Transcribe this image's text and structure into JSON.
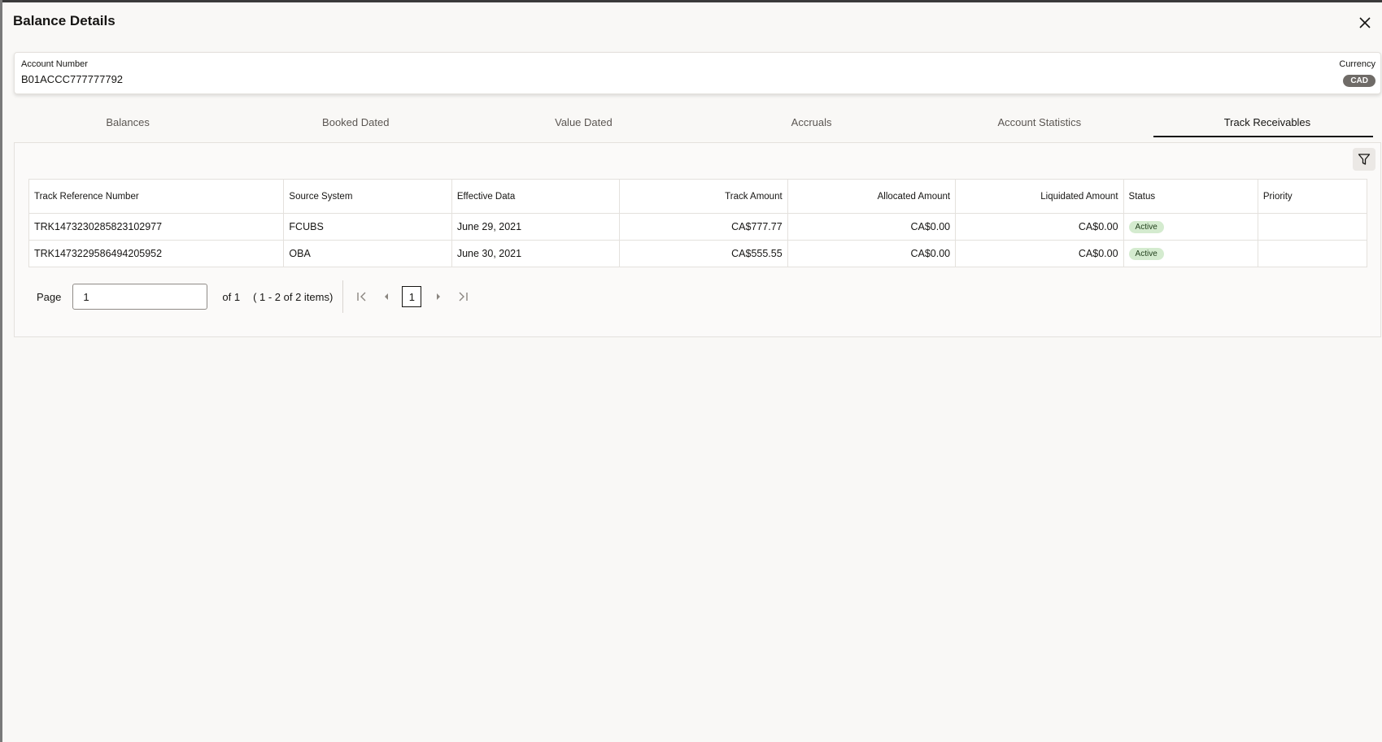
{
  "dialog": {
    "title": "Balance Details"
  },
  "account": {
    "number_label": "Account Number",
    "number_value": "B01ACCC777777792",
    "currency_label": "Currency",
    "currency_value": "CAD"
  },
  "tabs": [
    {
      "label": "Balances",
      "active": false
    },
    {
      "label": "Booked Dated",
      "active": false
    },
    {
      "label": "Value Dated",
      "active": false
    },
    {
      "label": "Accruals",
      "active": false
    },
    {
      "label": "Account Statistics",
      "active": false
    },
    {
      "label": "Track Receivables",
      "active": true
    }
  ],
  "table": {
    "columns": [
      "Track Reference Number",
      "Source System",
      "Effective Data",
      "Track Amount",
      "Allocated Amount",
      "Liquidated Amount",
      "Status",
      "Priority"
    ],
    "rows": [
      {
        "ref": "TRK1473230285823102977",
        "source": "FCUBS",
        "date": "June 29, 2021",
        "track_amount": "CA$777.77",
        "allocated": "CA$0.00",
        "liquidated": "CA$0.00",
        "status": "Active",
        "priority": ""
      },
      {
        "ref": "TRK1473229586494205952",
        "source": "OBA",
        "date": "June 30, 2021",
        "track_amount": "CA$555.55",
        "allocated": "CA$0.00",
        "liquidated": "CA$0.00",
        "status": "Active",
        "priority": ""
      }
    ]
  },
  "pager": {
    "page_label": "Page",
    "page_value": "1",
    "of_label": "of 1",
    "items_label": "( 1 - 2 of 2 items)",
    "current_page": "1"
  },
  "colors": {
    "status_active_bg": "#d4ebcf",
    "currency_badge_bg": "#6f6b67",
    "tab_active_underline": "#161513"
  },
  "icons": [
    "close-icon",
    "filter-icon",
    "first-page-icon",
    "prev-page-icon",
    "next-page-icon",
    "last-page-icon"
  ]
}
